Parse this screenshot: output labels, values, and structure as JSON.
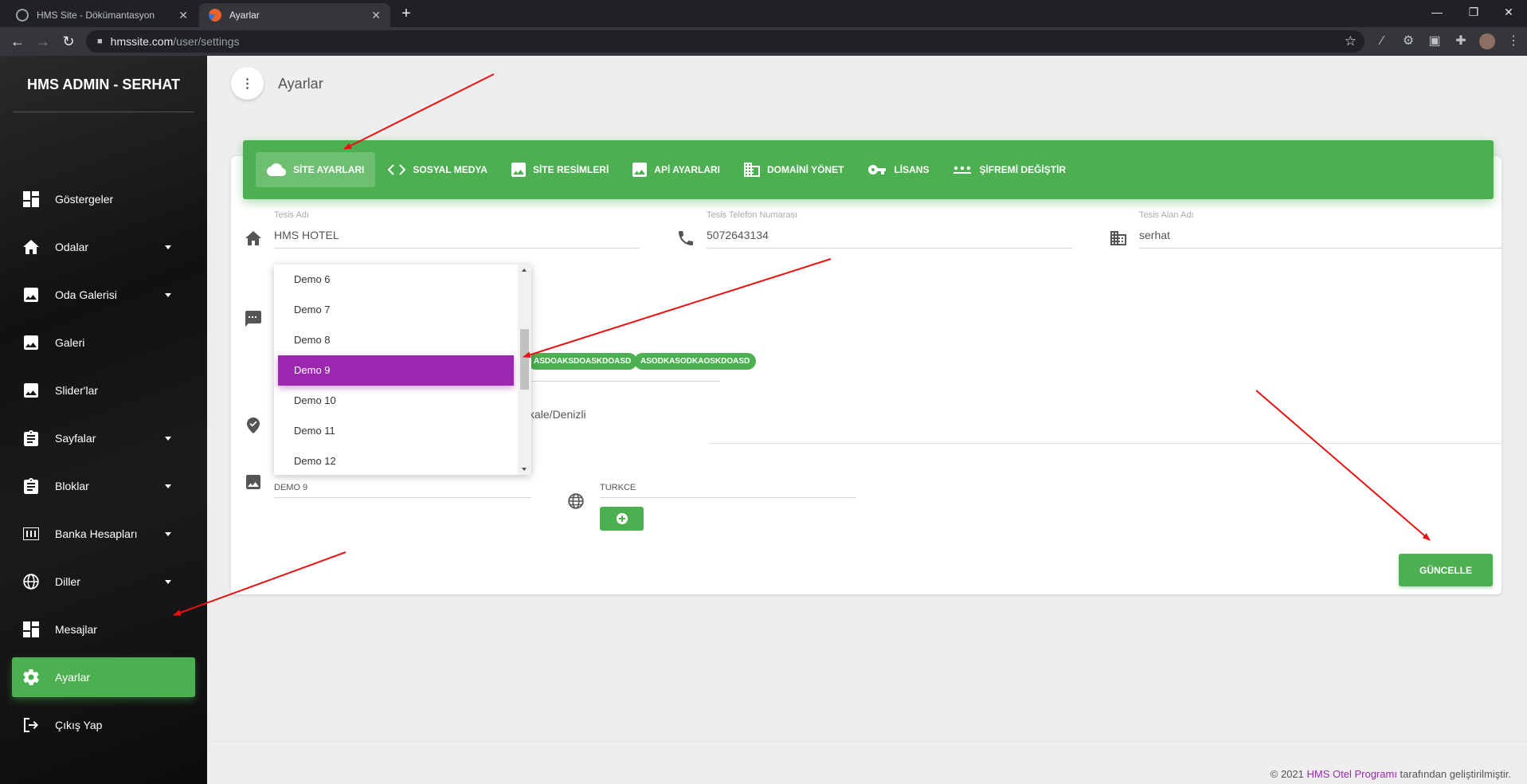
{
  "browser": {
    "tabs": [
      {
        "title": "HMS Site - Dökümantasyon",
        "favicon_color": "#9aa0a6"
      },
      {
        "title": "Ayarlar",
        "favicon_color": "#e8632b"
      }
    ],
    "url_host": "hmssite.com",
    "url_path": "/user/settings"
  },
  "sidebar": {
    "brand": "HMS ADMIN - SERHAT",
    "items": [
      {
        "label": "Göstergeler",
        "icon": "dashboard-icon",
        "caret": false
      },
      {
        "label": "Odalar",
        "icon": "home-icon",
        "caret": true
      },
      {
        "label": "Oda Galerisi",
        "icon": "image-icon",
        "caret": true
      },
      {
        "label": "Galeri",
        "icon": "image-icon",
        "caret": false
      },
      {
        "label": "Slider'lar",
        "icon": "image-icon",
        "caret": false
      },
      {
        "label": "Sayfalar",
        "icon": "clipboard-icon",
        "caret": true
      },
      {
        "label": "Bloklar",
        "icon": "clipboard-icon",
        "caret": true
      },
      {
        "label": "Banka Hesapları",
        "icon": "pin-icon",
        "caret": true
      },
      {
        "label": "Diller",
        "icon": "globe-icon",
        "caret": true
      },
      {
        "label": "Mesajlar",
        "icon": "dashboard-icon",
        "caret": false
      },
      {
        "label": "Ayarlar",
        "icon": "gear-icon",
        "caret": false,
        "active": true
      },
      {
        "label": "Çıkış Yap",
        "icon": "logout-icon",
        "caret": false
      }
    ]
  },
  "page": {
    "title": "Ayarlar"
  },
  "tabs": [
    {
      "label": "SİTE AYARLARI",
      "icon": "cloud-icon",
      "active": true
    },
    {
      "label": "SOSYAL MEDYA",
      "icon": "code-icon"
    },
    {
      "label": "SİTE RESİMLERİ",
      "icon": "image-icon"
    },
    {
      "label": "APİ AYARLARI",
      "icon": "image-icon"
    },
    {
      "label": "DOMAİNİ YÖNET",
      "icon": "building-icon"
    },
    {
      "label": "LİSANS",
      "icon": "key-icon"
    },
    {
      "label": "ŞİFREMİ DEĞİŞTİR",
      "icon": "password-icon"
    }
  ],
  "form": {
    "tesis_adi": {
      "label": "Tesis Adı",
      "value": "HMS HOTEL"
    },
    "telefon": {
      "label": "Tesis Telefon Numarası",
      "value": "5072643134"
    },
    "alan_adi": {
      "label": "Tesis Alan Adı",
      "value": "serhat"
    },
    "keywords": [
      "ASDOAKSDOASKDOASD",
      "ASODKASODKAOSKDOASD"
    ],
    "address_partial": "kale/Denizli",
    "theme_value": "DEMO 9",
    "language_value": "TURKCE"
  },
  "dropdown": {
    "options": [
      "Demo 6",
      "Demo 7",
      "Demo 8",
      "Demo 9",
      "Demo 10",
      "Demo 11",
      "Demo 12"
    ],
    "selected_index": 3
  },
  "buttons": {
    "update": "GÜNCELLE"
  },
  "footer": {
    "prefix": "© 2021 ",
    "brand": "HMS Otel Programı",
    "suffix": " tarafından geliştirilmiştir."
  },
  "colors": {
    "green": "#4caf50",
    "purple": "#9c27b0",
    "annotation": "#e81212"
  }
}
